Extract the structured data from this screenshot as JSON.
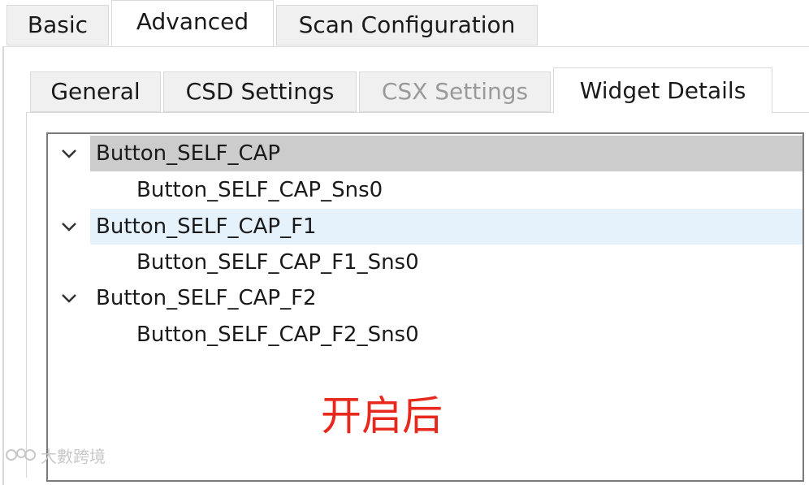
{
  "outer_tabs": {
    "basic": "Basic",
    "advanced": "Advanced",
    "scan": "Scan Configuration",
    "active": "Advanced"
  },
  "inner_tabs": {
    "general": "General",
    "csd": "CSD Settings",
    "csx": "CSX Settings",
    "widget": "Widget Details",
    "active": "Widget Details",
    "disabled": [
      "CSX Settings"
    ]
  },
  "tree": {
    "items": [
      {
        "label": "Button_SELF_CAP",
        "expanded": true,
        "state": "selected",
        "children": [
          {
            "label": "Button_SELF_CAP_Sns0"
          }
        ]
      },
      {
        "label": "Button_SELF_CAP_F1",
        "expanded": true,
        "state": "hover",
        "children": [
          {
            "label": "Button_SELF_CAP_F1_Sns0"
          }
        ]
      },
      {
        "label": "Button_SELF_CAP_F2",
        "expanded": true,
        "state": "normal",
        "children": [
          {
            "label": "Button_SELF_CAP_F2_Sns0"
          }
        ]
      }
    ]
  },
  "caption": "开启后",
  "watermark": "大數跨境",
  "colors": {
    "tab_inactive_bg": "#f0f0f0",
    "border": "#d9d9d9",
    "tree_border": "#7a7a7a",
    "selected_row": "#cccccc",
    "hover_row": "#e5f1fb",
    "caption": "#e8281c",
    "disabled_text": "#9a9a9a"
  }
}
